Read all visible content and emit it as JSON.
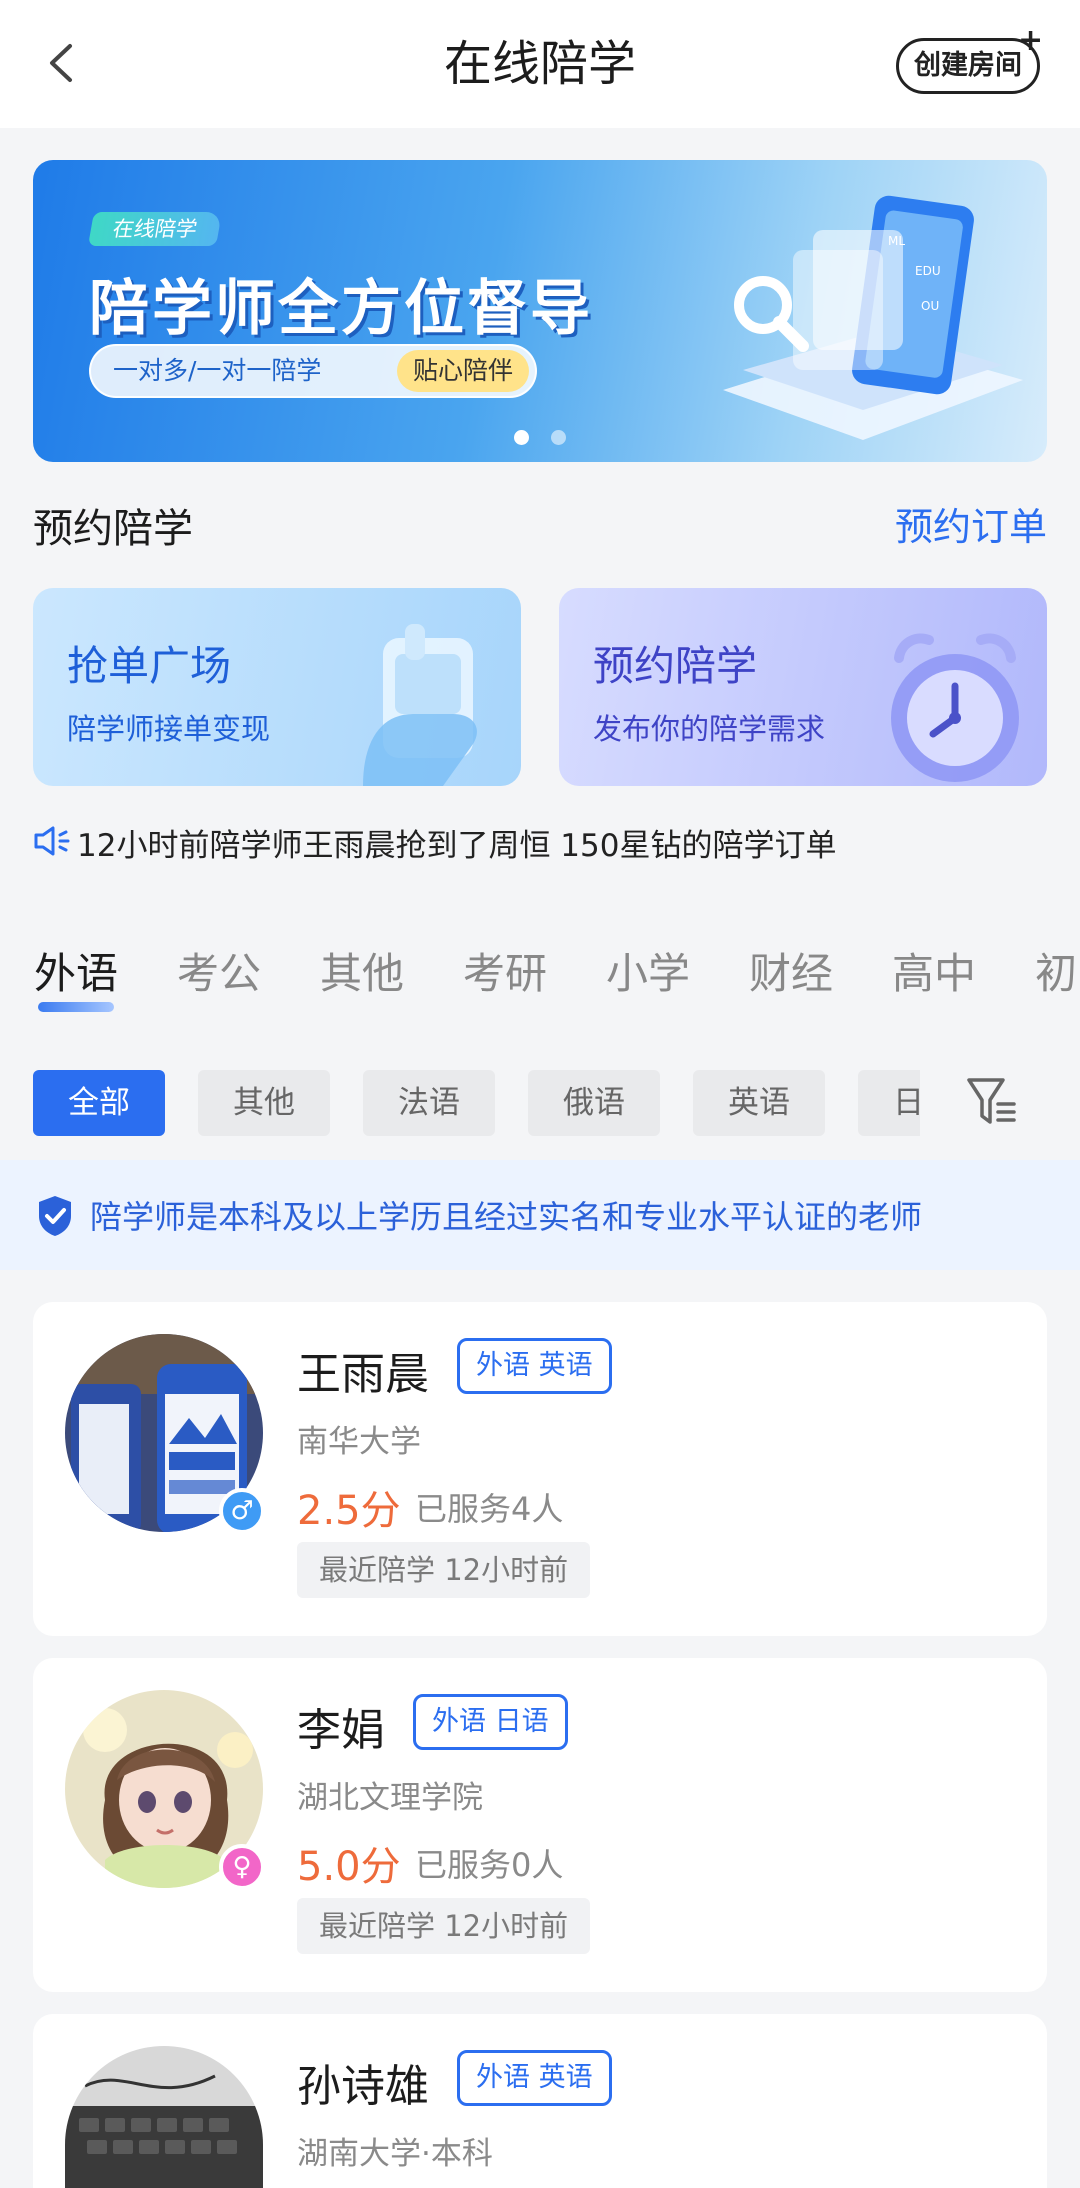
{
  "header": {
    "title": "在线陪学",
    "create_room_label": "创建房间",
    "create_room_plus": "+"
  },
  "banner": {
    "tag": "在线陪学",
    "headline": "陪学师全方位督导",
    "pill_text": "一对多/一对一陪学",
    "pill_highlight": "贴心陪伴",
    "art_labels": [
      "ML",
      "EDU",
      "OU"
    ],
    "slides_total": 2,
    "active_slide": 1
  },
  "section": {
    "title": "预约陪学",
    "link": "预约订单"
  },
  "action_cards": [
    {
      "title": "抢单广场",
      "subtitle": "陪学师接单变现",
      "icon": "hand-phone-icon"
    },
    {
      "title": "预约陪学",
      "subtitle": "发布你的陪学需求",
      "icon": "alarm-clock-icon"
    }
  ],
  "notice": {
    "icon": "speaker-icon",
    "text": "12小时前陪学师王雨晨抢到了周恒 150星钻的陪学订单"
  },
  "category_tabs": [
    {
      "label": "外语",
      "active": true
    },
    {
      "label": "考公",
      "active": false
    },
    {
      "label": "其他",
      "active": false
    },
    {
      "label": "考研",
      "active": false
    },
    {
      "label": "小学",
      "active": false
    },
    {
      "label": "财经",
      "active": false
    },
    {
      "label": "高中",
      "active": false
    },
    {
      "label": "初中",
      "active": false
    }
  ],
  "filter_chips": [
    {
      "label": "全部",
      "active": true
    },
    {
      "label": "其他",
      "active": false
    },
    {
      "label": "法语",
      "active": false
    },
    {
      "label": "俄语",
      "active": false
    },
    {
      "label": "英语",
      "active": false
    },
    {
      "label": "日语",
      "active": false
    }
  ],
  "trust_notice": {
    "icon": "shield-check-icon",
    "text": "陪学师是本科及以上学历且经过实名和专业水平认证的老师"
  },
  "tutors": [
    {
      "name": "王雨晨",
      "tag": "外语 英语",
      "school": "南华大学",
      "score": "2.5分",
      "served": "已服务4人",
      "recent": "最近陪学 12小时前",
      "gender": "male",
      "gender_symbol": "♂"
    },
    {
      "name": "李娟",
      "tag": "外语 日语",
      "school": "湖北文理学院",
      "score": "5.0分",
      "served": "已服务0人",
      "recent": "最近陪学 12小时前",
      "gender": "female",
      "gender_symbol": "♀"
    },
    {
      "name": "孙诗雄",
      "tag": "外语 英语",
      "school": "湖南大学·本科"
    }
  ],
  "colors": {
    "accent": "#2b6ef0",
    "score": "#ee6b3b",
    "page_bg": "#f4f5f7"
  }
}
